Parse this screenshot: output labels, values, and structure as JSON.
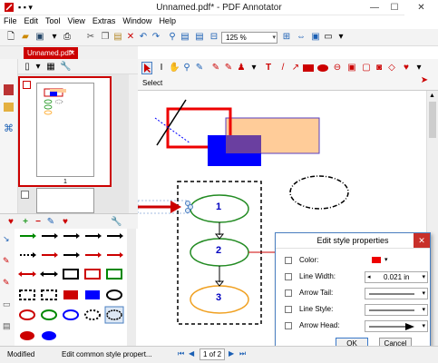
{
  "window": {
    "title": "Unnamed.pdf* - PDF Annotator"
  },
  "menu": [
    "File",
    "Edit",
    "Tool",
    "View",
    "Extras",
    "Window",
    "Help"
  ],
  "toolbar": {
    "zoom_value": "125 %"
  },
  "tabs": {
    "document": "Unnamed.pdf*"
  },
  "thumbnails": {
    "page1_number": "1"
  },
  "tools": {
    "select_label": "Select"
  },
  "canvas": {
    "node1": "1",
    "node2": "2",
    "node3": "3"
  },
  "dialog": {
    "title": "Edit style properties",
    "color_label": "Color:",
    "line_width_label": "Line Width:",
    "line_width_value": "0.021 in",
    "arrow_tail_label": "Arrow Tail:",
    "line_style_label": "Line Style:",
    "arrow_head_label": "Arrow Head:",
    "ok": "OK",
    "cancel": "Cancel"
  },
  "status": {
    "state": "Modified",
    "hint": "Edit common style propert...",
    "page_indicator": "1 of 2"
  },
  "colors": {
    "accent": "#cc0000",
    "blue": "#0000ff",
    "orange": "#ffcc99",
    "green": "#228b22"
  }
}
